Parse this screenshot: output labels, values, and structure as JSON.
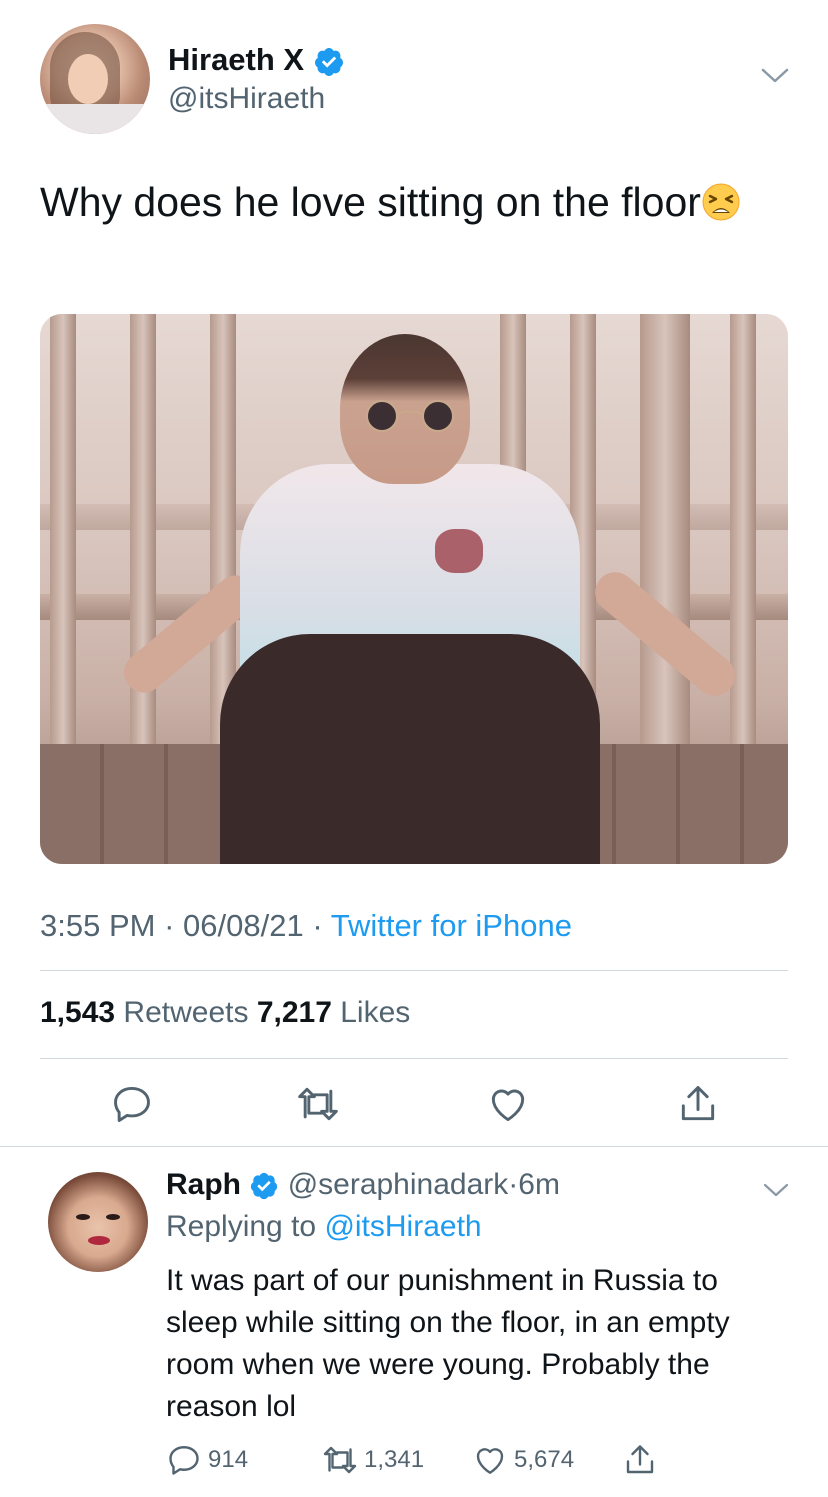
{
  "tweet": {
    "author_name": "Hiraeth X",
    "author_handle": "@itsHiraeth",
    "text": "Why does he love sitting on the floor",
    "emoji": "tired-face-emoji",
    "time": "3:55 PM",
    "date": "06/08/21",
    "separator": "·",
    "source": "Twitter for iPhone",
    "retweets_count": "1,543",
    "retweets_label": "Retweets",
    "likes_count": "7,217",
    "likes_label": "Likes"
  },
  "reply": {
    "author_name": "Raph",
    "author_handle": "@seraphinadark",
    "time_ago": "6m",
    "separator": "·",
    "replying_label": "Replying to",
    "replying_mention": "@itsHiraeth",
    "text": "It was part of our punishment in Russia to sleep while sitting on the floor, in an empty room when we were young. Probably the reason lol",
    "replies_count": "914",
    "retweets_count": "1,341",
    "likes_count": "5,674"
  },
  "icons": {
    "verified": "verified-badge-icon",
    "chevron": "chevron-down-icon",
    "reply": "reply-icon",
    "retweet": "retweet-icon",
    "like": "heart-icon",
    "share": "share-icon"
  },
  "colors": {
    "accent": "#1d9bf0",
    "text_primary": "#0f1419",
    "text_secondary": "#536471",
    "divider": "#cfd9de"
  }
}
